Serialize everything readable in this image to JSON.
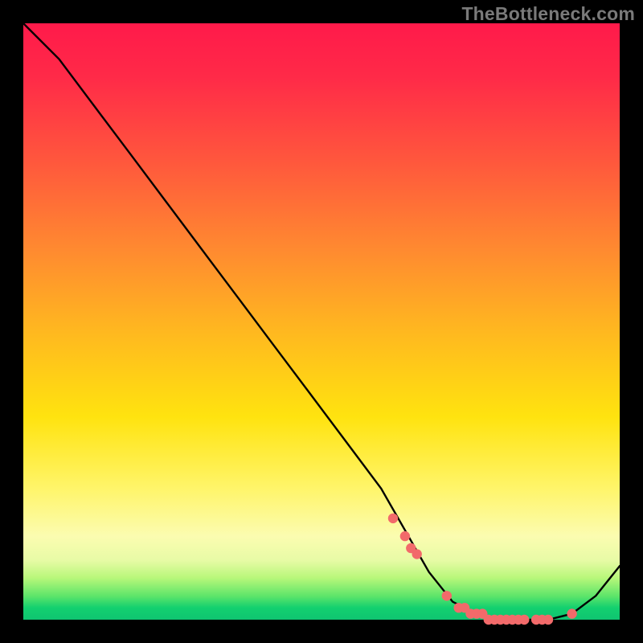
{
  "watermark": "TheBottleneck.com",
  "colors": {
    "background": "#000000",
    "curve": "#000000",
    "dots": "#f26a6a",
    "gradient_top": "#ff1a4a",
    "gradient_mid": "#ffe30f",
    "gradient_bottom": "#13d06f"
  },
  "chart_data": {
    "type": "line",
    "title": "",
    "xlabel": "",
    "ylabel": "",
    "xlim": [
      0,
      100
    ],
    "ylim": [
      0,
      100
    ],
    "series": [
      {
        "name": "bottleneck-curve",
        "x": [
          0,
          6,
          12,
          18,
          24,
          30,
          36,
          42,
          48,
          54,
          60,
          64,
          68,
          72,
          76,
          80,
          84,
          88,
          92,
          96,
          100
        ],
        "y": [
          100,
          94,
          86,
          78,
          70,
          62,
          54,
          46,
          38,
          30,
          22,
          15,
          8,
          3,
          1,
          0,
          0,
          0,
          1,
          4,
          9
        ]
      }
    ],
    "highlight_points": {
      "name": "highlighted-dots",
      "x": [
        62,
        64,
        65,
        66,
        71,
        73,
        74,
        75,
        76,
        77,
        78,
        79,
        80,
        81,
        82,
        83,
        84,
        86,
        87,
        88,
        92
      ],
      "y": [
        17,
        14,
        12,
        11,
        4,
        2,
        2,
        1,
        1,
        1,
        0,
        0,
        0,
        0,
        0,
        0,
        0,
        0,
        0,
        0,
        1
      ]
    }
  }
}
